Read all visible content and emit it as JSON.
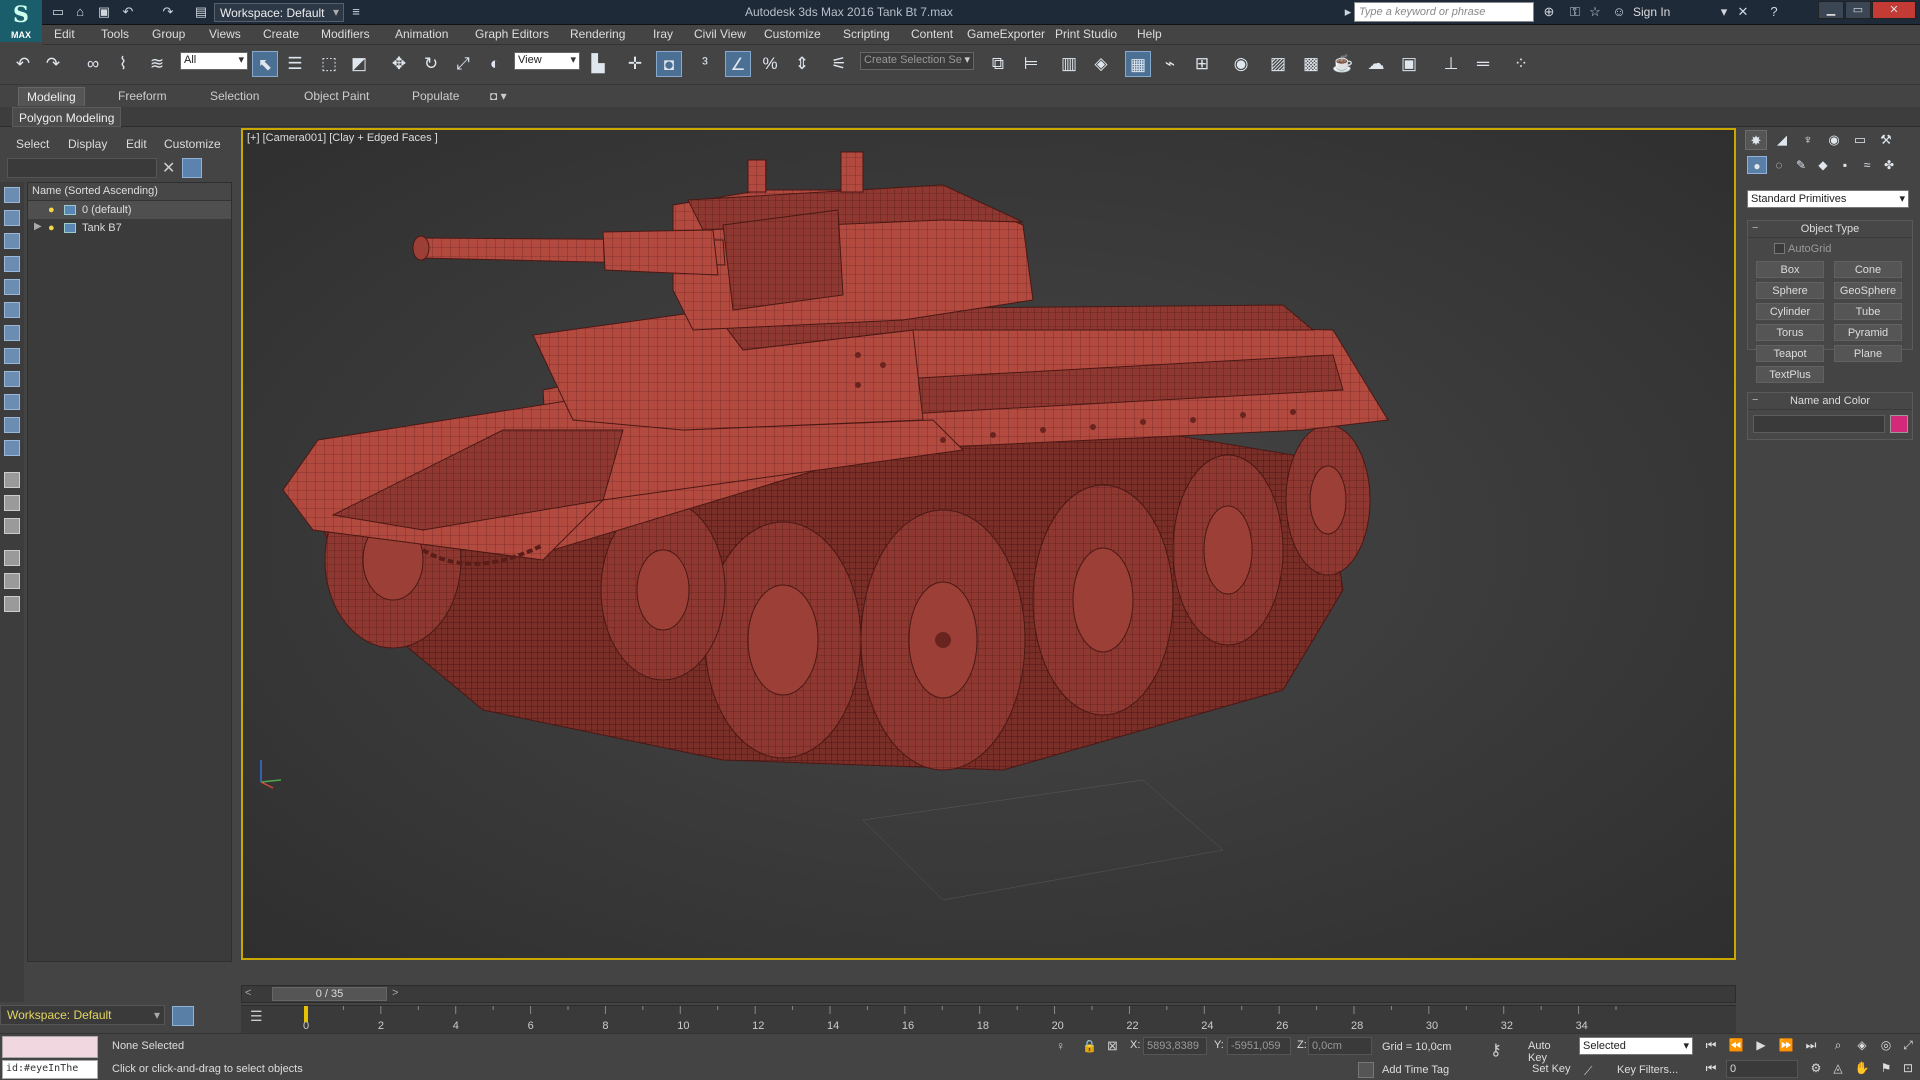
{
  "titlebar": {
    "logo": "MAX",
    "workspace": "Workspace: Default",
    "title": "Autodesk 3ds Max 2016     Tank Bt 7.max",
    "search_placeholder": "Type a keyword or phrase",
    "signin": "Sign In"
  },
  "menu": [
    "Edit",
    "Tools",
    "Group",
    "Views",
    "Create",
    "Modifiers",
    "Animation",
    "Graph Editors",
    "Rendering",
    "Iray",
    "Civil View",
    "Customize",
    "Scripting",
    "Content",
    "GameExporter",
    "Print Studio",
    "Help"
  ],
  "toolbar": {
    "filter": "All",
    "ref_coord": "View",
    "selection_set": "Create Selection Se"
  },
  "ribbon": {
    "tabs": [
      "Modeling",
      "Freeform",
      "Selection",
      "Object Paint",
      "Populate"
    ],
    "active_tab": "Modeling",
    "panel": "Polygon Modeling"
  },
  "scene_explorer": {
    "menu": [
      "Select",
      "Display",
      "Edit",
      "Customize"
    ],
    "header": "Name (Sorted Ascending)",
    "rows": [
      {
        "name": "0 (default)"
      },
      {
        "name": "Tank B7"
      }
    ]
  },
  "viewport": {
    "label": "[+] [Camera001] [Clay + Edged Faces ]",
    "model_color": "#b34a40"
  },
  "timeline": {
    "frame": "0 / 35",
    "ticks": [
      "0",
      "2",
      "4",
      "6",
      "8",
      "10",
      "12",
      "14",
      "16",
      "18",
      "20",
      "22",
      "24",
      "26",
      "28",
      "30",
      "32",
      "34"
    ]
  },
  "workspace_bottom": "Workspace: Default",
  "status": {
    "maxscript_text": "id:#eyeInThe",
    "selection": "None Selected",
    "prompt": "Click or click-and-drag to select objects",
    "x_label": "X:",
    "x_value": "5893,8389",
    "y_label": "Y:",
    "y_value": "-5951,059",
    "z_label": "Z:",
    "z_value": "0,0cm",
    "grid": "Grid = 10,0cm",
    "add_time_tag": "Add Time Tag",
    "auto_key": "Auto Key",
    "set_key": "Set Key",
    "selected_dd": "Selected",
    "key_filters": "Key Filters...",
    "frame_value": "0"
  },
  "command_panel": {
    "primitive_type": "Standard Primitives",
    "object_type_title": "Object Type",
    "autogrid": "AutoGrid",
    "buttons": [
      "Box",
      "Cone",
      "Sphere",
      "GeoSphere",
      "Cylinder",
      "Tube",
      "Torus",
      "Pyramid",
      "Teapot",
      "Plane",
      "TextPlus"
    ],
    "name_color_title": "Name and Color",
    "swatch_color": "#d4287a"
  }
}
